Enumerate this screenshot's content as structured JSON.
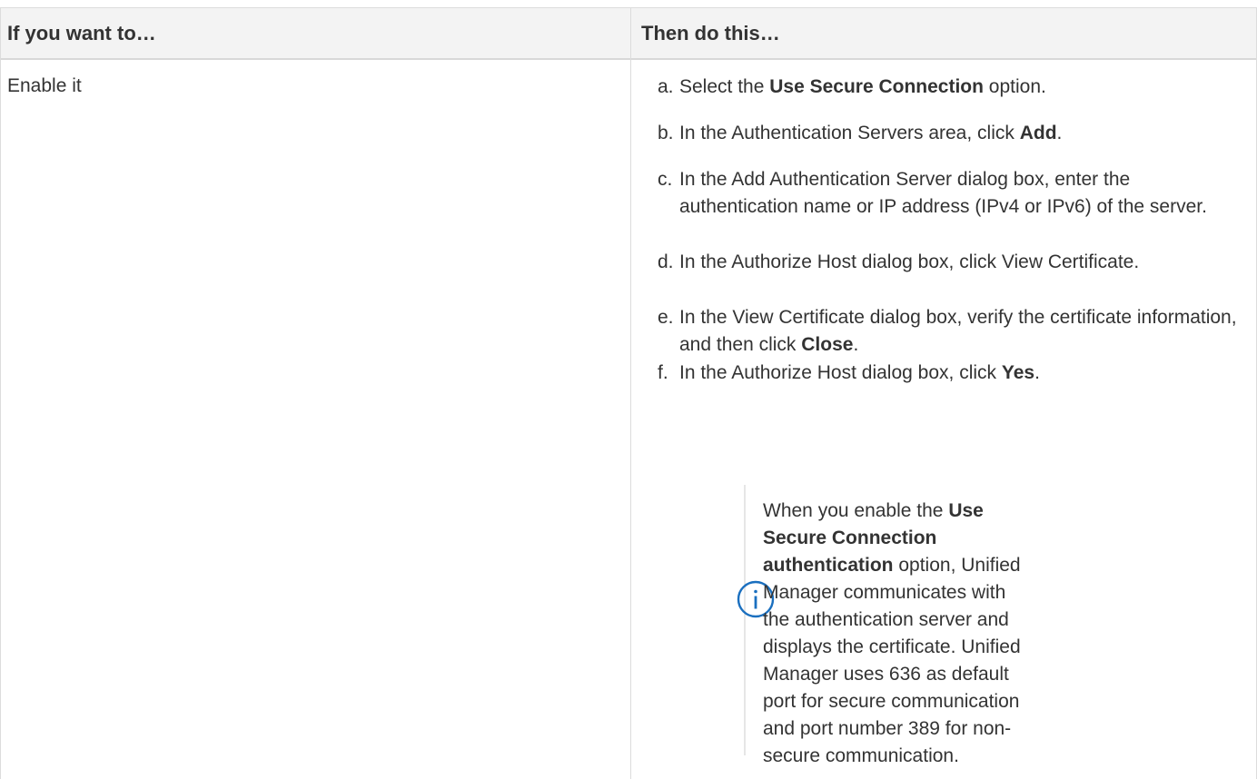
{
  "table": {
    "headers": {
      "col1": "If you want to…",
      "col2": "Then do this…"
    },
    "row": {
      "action": "Enable it",
      "steps": [
        {
          "marker": "a.",
          "parts": [
            {
              "text": "Select the ",
              "bold": false
            },
            {
              "text": "Use Secure Connection",
              "bold": true
            },
            {
              "text": " option.",
              "bold": false
            }
          ]
        },
        {
          "marker": "b.",
          "parts": [
            {
              "text": "In the Authentication Servers area, click ",
              "bold": false
            },
            {
              "text": "Add",
              "bold": true
            },
            {
              "text": ".",
              "bold": false
            }
          ]
        },
        {
          "marker": "c.",
          "parts": [
            {
              "text": "In the Add Authentication Server dialog box, enter the authentication name or IP address (IPv4 or IPv6) of the server.",
              "bold": false
            }
          ]
        },
        {
          "marker": "d.",
          "parts": [
            {
              "text": "In the Authorize Host dialog box, click View Certificate.",
              "bold": false
            }
          ]
        },
        {
          "marker": "e.",
          "parts": [
            {
              "text": "In the View Certificate dialog box, verify the certificate information, and then click ",
              "bold": false
            },
            {
              "text": "Close",
              "bold": true
            },
            {
              "text": ".",
              "bold": false
            }
          ]
        },
        {
          "marker": "f.",
          "parts": [
            {
              "text": "In the Authorize Host dialog box, click ",
              "bold": false
            },
            {
              "text": "Yes",
              "bold": true
            },
            {
              "text": ".",
              "bold": false
            }
          ]
        }
      ],
      "note": {
        "icon": "info-icon",
        "icon_color": "#1a6fbf",
        "parts": [
          {
            "text": "When you enable the ",
            "bold": false
          },
          {
            "text": "Use Secure Connection authentication",
            "bold": true
          },
          {
            "text": " option, Unified Manager communicates with the authentication server and displays the certificate. Unified Manager uses 636 as default port for secure communication and port number 389 for non-secure communication.",
            "bold": false
          }
        ]
      }
    }
  }
}
